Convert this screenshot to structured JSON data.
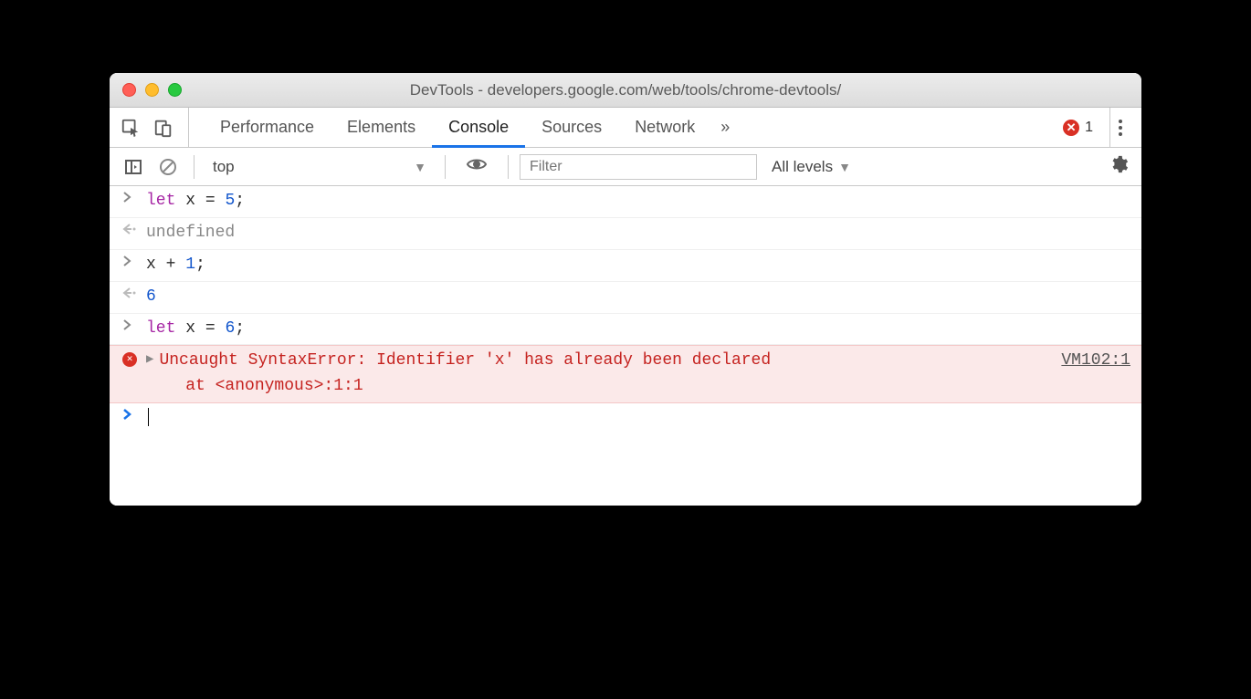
{
  "window": {
    "title": "DevTools - developers.google.com/web/tools/chrome-devtools/"
  },
  "tabs": {
    "items": [
      "Performance",
      "Elements",
      "Console",
      "Sources",
      "Network"
    ],
    "active_index": 2,
    "overflow_glyph": "»",
    "error_count": "1"
  },
  "toolbar": {
    "context": "top",
    "filter_placeholder": "Filter",
    "levels_label": "All levels"
  },
  "console": {
    "lines": [
      {
        "kind": "input",
        "tokens": [
          {
            "cls": "kw",
            "t": "let"
          },
          {
            "cls": "",
            "t": " "
          },
          {
            "cls": "ident",
            "t": "x"
          },
          {
            "cls": "",
            "t": " "
          },
          {
            "cls": "op",
            "t": "="
          },
          {
            "cls": "",
            "t": " "
          },
          {
            "cls": "num",
            "t": "5"
          },
          {
            "cls": "punct",
            "t": ";"
          }
        ]
      },
      {
        "kind": "result",
        "tokens": [
          {
            "cls": "undef",
            "t": "undefined"
          }
        ]
      },
      {
        "kind": "input",
        "tokens": [
          {
            "cls": "ident",
            "t": "x"
          },
          {
            "cls": "",
            "t": " "
          },
          {
            "cls": "op",
            "t": "+"
          },
          {
            "cls": "",
            "t": " "
          },
          {
            "cls": "num",
            "t": "1"
          },
          {
            "cls": "punct",
            "t": ";"
          }
        ]
      },
      {
        "kind": "result",
        "tokens": [
          {
            "cls": "resnum",
            "t": "6"
          }
        ]
      },
      {
        "kind": "input",
        "tokens": [
          {
            "cls": "kw",
            "t": "let"
          },
          {
            "cls": "",
            "t": " "
          },
          {
            "cls": "ident",
            "t": "x"
          },
          {
            "cls": "",
            "t": " "
          },
          {
            "cls": "op",
            "t": "="
          },
          {
            "cls": "",
            "t": " "
          },
          {
            "cls": "num",
            "t": "6"
          },
          {
            "cls": "punct",
            "t": ";"
          }
        ]
      },
      {
        "kind": "error",
        "message": "Uncaught SyntaxError: Identifier 'x' has already been declared",
        "trace": "    at <anonymous>:1:1",
        "link": "VM102:1"
      },
      {
        "kind": "prompt"
      }
    ]
  }
}
